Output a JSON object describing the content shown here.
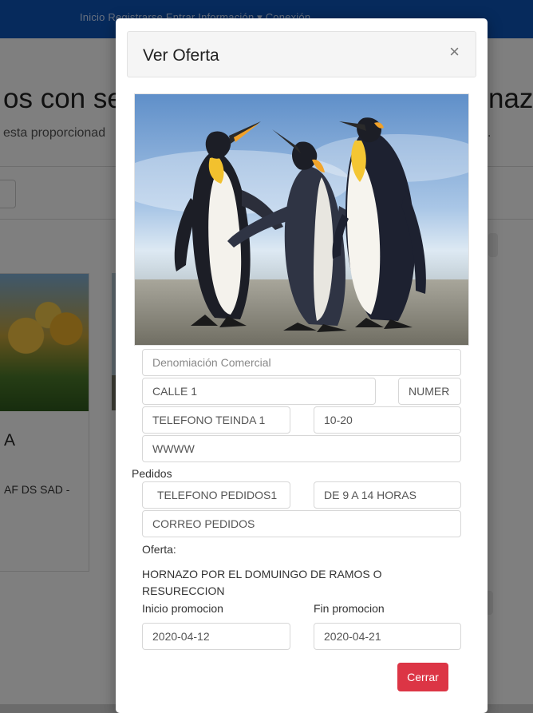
{
  "background": {
    "nav_text": "Inicio   Registrarse   Entrar   Información ▾   Conexión",
    "heading_left": "os con se",
    "heading_right": "nazo",
    "subtitle_left": "esta proporcionad",
    "subtitle_right": ".",
    "card_title": "A",
    "card_text": "AF DS SAD -"
  },
  "modal": {
    "title": "Ver Oferta",
    "close_symbol": "×",
    "fields": {
      "denominacion_placeholder": "Denomiación Comercial",
      "calle": "CALLE 1",
      "numero": "NUMER",
      "telefono_tienda": "TELEFONO TEINDA 1",
      "horario_tienda": "10-20",
      "web": "WWWW",
      "telefono_pedidos": "TELEFONO PEDIDOS1",
      "horario_pedidos": "DE 9 A 14 HORAS",
      "correo_pedidos": "CORREO PEDIDOS"
    },
    "labels": {
      "pedidos": "Pedidos",
      "oferta": "Oferta:",
      "inicio": "Inicio promocion",
      "fin": "Fin promocion"
    },
    "oferta_text": "HORNAZO POR EL DOMUINGO DE RAMOS O RESURECCION",
    "inicio_promocion": "2020-04-12",
    "fin_promocion": "2020-04-21",
    "close_button": "Cerrar"
  },
  "colors": {
    "navbar": "#0d54b8",
    "danger_button": "#dc3545"
  },
  "icons": [
    "close-icon"
  ]
}
